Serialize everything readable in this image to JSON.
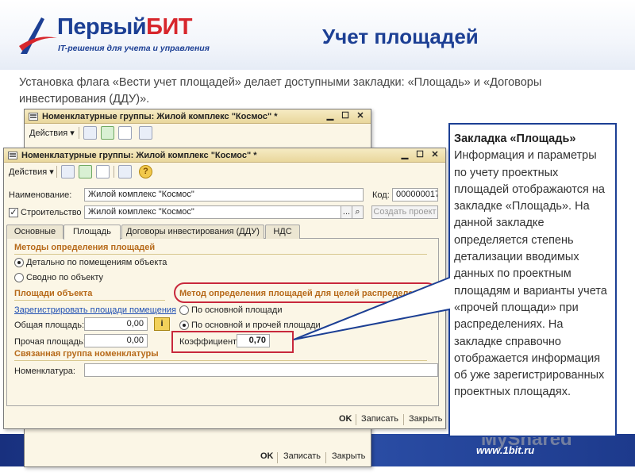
{
  "logo": {
    "name_part1": "Первый",
    "name_part2": "БИТ",
    "tagline": "IT-решения для учета и управления"
  },
  "slide": {
    "title": "Учет площадей",
    "intro": "Установка флага «Вести учет площадей» делает доступными закладки: «Площадь» и «Договоры инвестирования (ДДУ)»."
  },
  "back_window": {
    "title": "Номенклатурные группы: Жилой комплекс \"Космос\" *",
    "menu": "Действия ▾",
    "buttons": {
      "ok": "OK",
      "save": "Записать",
      "close": "Закрыть"
    }
  },
  "window": {
    "title": "Номенклатурные группы: Жилой комплекс \"Космос\" *",
    "menu": "Действия ▾",
    "help_icon": "?",
    "fields": {
      "name_label": "Наименование:",
      "name_value": "Жилой комплекс \"Космос\"",
      "code_label": "Код:",
      "code_value": "000000017",
      "construction_label": "Строительство",
      "construction_checked": "✓",
      "construction_value": "Жилой комплекс \"Космос\"",
      "select_button": "...",
      "create_project_button": "Создать проект"
    },
    "tabs": [
      "Основные",
      "Площадь",
      "Договоры инвестирования (ДДУ)",
      "НДС"
    ],
    "active_tab": "Площадь",
    "area_tab": {
      "methods_header": "Методы определения площадей",
      "method_detailed": "Детально по помещениям объекта",
      "method_summary": "Сводно по объекту",
      "distribution_header": "Метод определения площадей для целей распределения",
      "dist_option_main": "По основной площади",
      "dist_option_main_other": "По основной и прочей площади",
      "coef_label": "Коэффициент:",
      "coef_value": "0,70",
      "object_areas_header": "Площади объекта",
      "register_link": "Зарегистрировать площади помещения",
      "total_area_label": "Общая площадь:",
      "total_area_value": "0,00",
      "other_area_label": "Прочая площадь:",
      "other_area_value": "0,00",
      "info_icon": "i",
      "related_group_header": "Связанная группа номенклатуры",
      "nomenclature_label": "Номенклатура:",
      "nomenclature_value": ""
    },
    "buttons": {
      "ok": "OK",
      "save": "Записать",
      "close": "Закрыть"
    }
  },
  "callout": {
    "heading": "Закладка «Площадь»",
    "body": "Информация и параметры по учету проектных площадей отображаются на закладке «Площадь». На данной закладке определяется степень детализации вводимых данных по проектным площадям и варианты учета «прочей площади» при распределениях. На закладке справочно отображается информация об уже зарегистрированных проектных площадях."
  },
  "footer": {
    "url": "www.1bit.ru",
    "watermark": "MyShared"
  },
  "colors": {
    "brand_blue": "#1c3f94",
    "brand_red": "#d7262c",
    "highlight_red": "#c8283c",
    "section_orange": "#b76a1a",
    "window_bg": "#fbf6e6"
  }
}
